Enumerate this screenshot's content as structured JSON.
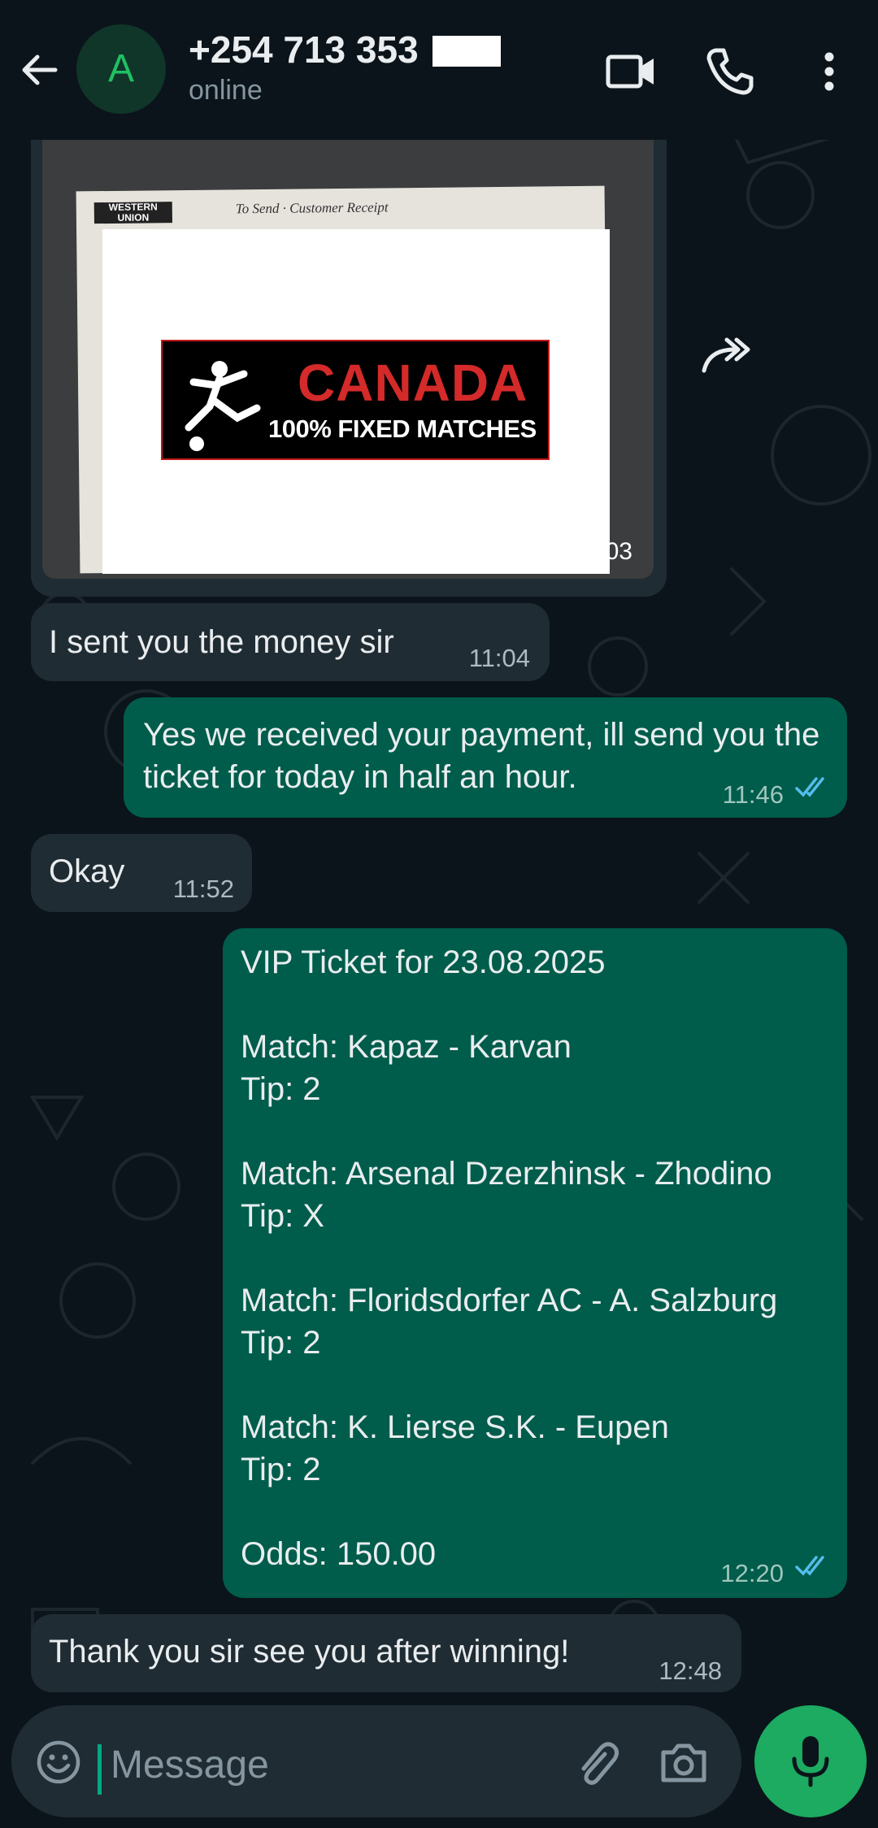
{
  "header": {
    "avatar_letter": "A",
    "contact_name": "+254 713 353",
    "status": "online"
  },
  "messages": [
    {
      "type": "image",
      "direction": "incoming",
      "image_receipt_text": "To Send · Customer Receipt",
      "image_receipt_logo": "WESTERN UNION",
      "image_banner_line1": "CANADA",
      "image_banner_line2": "100% FIXED MATCHES",
      "time": "11:03"
    },
    {
      "type": "text",
      "direction": "incoming",
      "text": "I sent you the money sir",
      "time": "11:04"
    },
    {
      "type": "text",
      "direction": "outgoing",
      "text": "Yes we received your payment, ill send you the ticket for today in half an hour.",
      "time": "11:46",
      "status": "read"
    },
    {
      "type": "text",
      "direction": "incoming",
      "text": "Okay",
      "time": "11:52"
    },
    {
      "type": "text",
      "direction": "outgoing",
      "text": "VIP Ticket for 23.08.2025\n\nMatch: Kapaz - Karvan\nTip: 2\n\nMatch: Arsenal Dzerzhinsk - Zhodino\nTip: X\n\nMatch: Floridsdorfer AC - A. Salzburg\nTip: 2\n\nMatch: K. Lierse S.K. - Eupen\nTip: 2\n\nOdds: 150.00",
      "time": "12:20",
      "status": "read"
    },
    {
      "type": "text",
      "direction": "incoming",
      "text": "Thank you sir see you after winning!",
      "time": "12:48"
    }
  ],
  "input": {
    "placeholder": "Message"
  },
  "icons": {
    "back": "arrow-left-icon",
    "video": "video-call-icon",
    "call": "phone-icon",
    "menu": "more-vert-icon",
    "forward": "forward-icon",
    "emoji": "emoji-icon",
    "attach": "paperclip-icon",
    "camera": "camera-icon",
    "mic": "mic-icon"
  },
  "colors": {
    "background": "#0b141a",
    "incoming_bubble": "#202c33",
    "outgoing_bubble": "#005c4b",
    "read_ticks": "#53bdeb",
    "accent": "#1daa61"
  }
}
